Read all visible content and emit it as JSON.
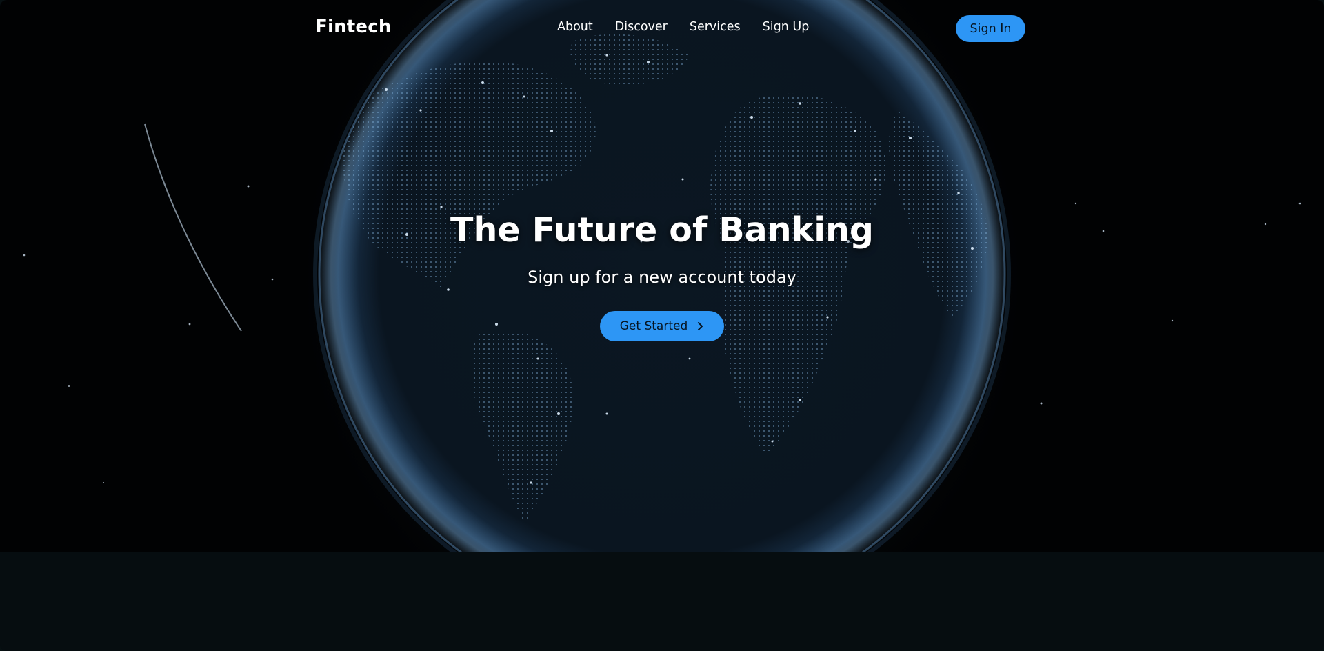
{
  "brand": {
    "name": "Fintech"
  },
  "nav": {
    "links": [
      "About",
      "Discover",
      "Services",
      "Sign Up"
    ],
    "signin_label": "Sign In"
  },
  "hero": {
    "title": "The Future of Banking",
    "subtitle": "Sign up for a new account today",
    "cta_label": "Get Started",
    "cta_icon": "chevron-right-icon"
  },
  "colors": {
    "accent": "#2d96f5",
    "background": "#000000",
    "footer_band": "#060d10",
    "globe_glow": "#7fb6e6"
  }
}
